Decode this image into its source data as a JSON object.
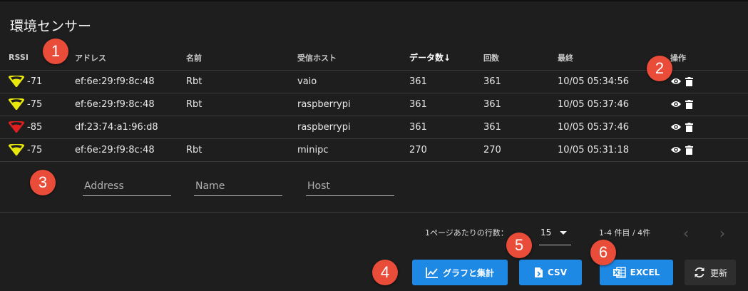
{
  "title": "環境センサー",
  "table": {
    "headers": {
      "rssi": "RSSI",
      "address": "アドレス",
      "name": "名前",
      "host": "受信ホスト",
      "count": "データ数",
      "sort_arrow": "↓",
      "times": "回数",
      "last": "最終",
      "ops": "操作"
    },
    "rows": [
      {
        "rssi": "-71",
        "signal": "good",
        "address": "ef:6e:29:f9:8c:48",
        "name": "Rbt",
        "host": "vaio",
        "count": "361",
        "times": "361",
        "last": "10/05 05:34:56"
      },
      {
        "rssi": "-75",
        "signal": "good",
        "address": "ef:6e:29:f9:8c:48",
        "name": "Rbt",
        "host": "raspberrypi",
        "count": "361",
        "times": "361",
        "last": "10/05 05:37:46"
      },
      {
        "rssi": "-85",
        "signal": "weak",
        "address": "df:23:74:a1:96:d8",
        "name": "",
        "host": "raspberrypi",
        "count": "361",
        "times": "361",
        "last": "10/05 05:37:46"
      },
      {
        "rssi": "-75",
        "signal": "good",
        "address": "ef:6e:29:f9:8c:48",
        "name": "Rbt",
        "host": "minipc",
        "count": "270",
        "times": "270",
        "last": "10/05 05:31:18"
      }
    ]
  },
  "filters": {
    "address_placeholder": "Address",
    "name_placeholder": "Name",
    "host_placeholder": "Host"
  },
  "pagination": {
    "rows_per_page_label": "1ページあたりの行数：",
    "rows_per_page_value": "15",
    "range_text": "1-4 件目 / 4件",
    "prev_icon": "chevron-left-icon",
    "next_icon": "chevron-right-icon"
  },
  "buttons": {
    "graph": "グラフと集計",
    "csv": "CSV",
    "excel": "EXCEL",
    "refresh": "更新"
  },
  "badges": [
    "1",
    "2",
    "3",
    "4",
    "5",
    "6"
  ],
  "colors": {
    "background": "#1e1e1e",
    "accent": "#1e88e5",
    "badge": "#ea4c3a",
    "signal_good": "#e8e80c",
    "signal_weak": "#e02020"
  }
}
